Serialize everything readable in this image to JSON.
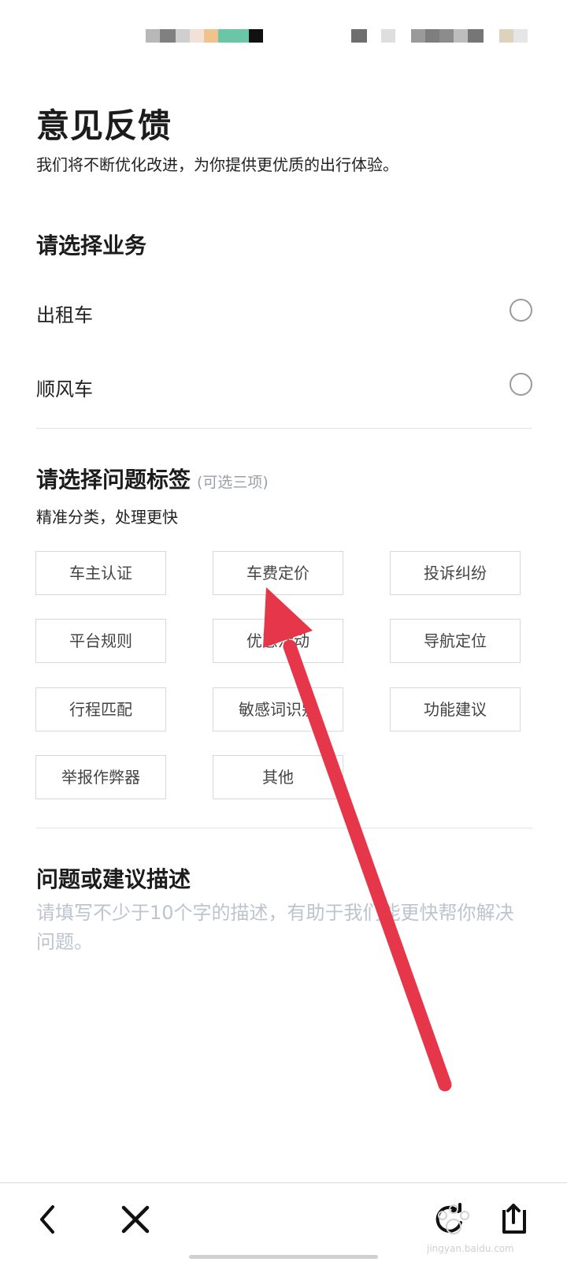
{
  "page": {
    "title": "意见反馈",
    "subtitle": "我们将不断优化改进，为你提供更优质的出行体验。"
  },
  "business_section": {
    "heading": "请选择业务",
    "options": [
      {
        "label": "出租车",
        "selected": false
      },
      {
        "label": "顺风车",
        "selected": false
      }
    ]
  },
  "tags_section": {
    "heading": "请选择问题标签",
    "hint": "(可选三项)",
    "description": "精准分类，处理更快",
    "tags": [
      "车主认证",
      "车费定价",
      "投诉纠纷",
      "平台规则",
      "优惠活动",
      "导航定位",
      "行程匹配",
      "敏感词识别",
      "功能建议",
      "举报作弊器",
      "其他"
    ]
  },
  "description_section": {
    "heading": "问题或建议描述",
    "placeholder": "请填写不少于10个字的描述，有助于我们能更快帮你解决问题。"
  },
  "bottom_nav": {
    "icons": [
      "back-icon",
      "close-icon",
      "refresh-icon",
      "share-icon"
    ]
  },
  "watermark": {
    "text": "jingyan.baidu.com"
  },
  "colors": {
    "annotation_arrow": "#e5364a",
    "placeholder_text": "#bcc4cf",
    "hint_text": "#9aa0a8"
  }
}
